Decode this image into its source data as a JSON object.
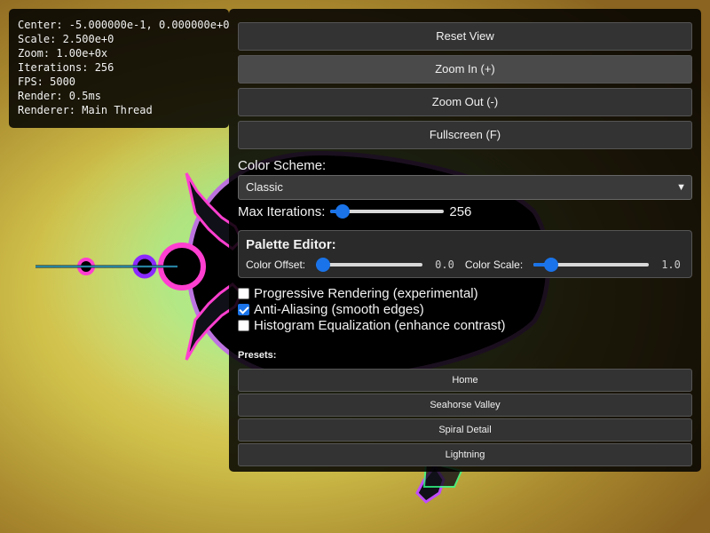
{
  "info": {
    "center": "Center: -5.000000e-1, 0.000000e+0",
    "scale": "Scale: 2.500e+0",
    "zoom": "Zoom: 1.00e+0x",
    "iterations": "Iterations: 256",
    "fps": "FPS: 5000",
    "render": "Render: 0.5ms",
    "renderer": "Renderer: Main Thread"
  },
  "controls": {
    "reset": "Reset View",
    "zoom_in": "Zoom In (+)",
    "zoom_out": "Zoom Out (-)",
    "fullscreen": "Fullscreen (F)",
    "color_scheme_label": "Color Scheme:",
    "color_scheme_value": "Classic",
    "max_iter_label": "Max Iterations:",
    "max_iter_value": "256",
    "max_iter_fraction": 0.05
  },
  "palette": {
    "title": "Palette Editor:",
    "offset_label": "Color Offset:",
    "offset_value": "0.0",
    "offset_fraction": 0.0,
    "scale_label": "Color Scale:",
    "scale_value": "1.0",
    "scale_fraction": 0.1
  },
  "options": [
    {
      "label": "Progressive Rendering (experimental)",
      "checked": false
    },
    {
      "label": "Anti-Aliasing (smooth edges)",
      "checked": true
    },
    {
      "label": "Histogram Equalization (enhance contrast)",
      "checked": false
    }
  ],
  "presets": {
    "title": "Presets:",
    "items": [
      "Home",
      "Seahorse Valley",
      "Spiral Detail",
      "Lightning"
    ]
  }
}
